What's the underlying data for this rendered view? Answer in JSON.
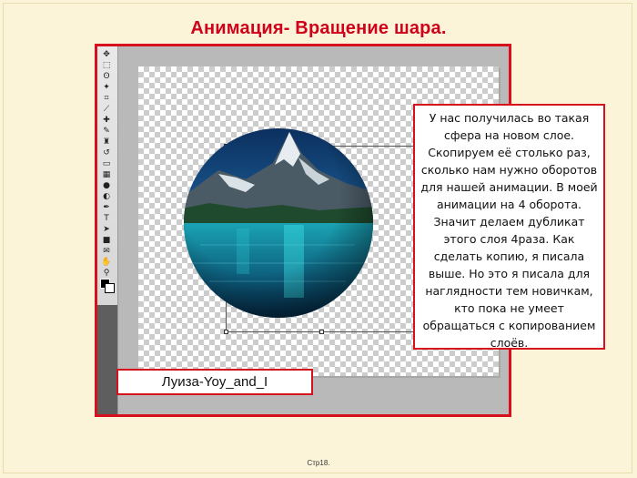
{
  "slide": {
    "title": "Анимация- Вращение шара.",
    "page_number": "Стр18."
  },
  "note": {
    "text": "У нас получилась во такая сфера на новом слое. Скопируем её столько раз, сколько нам нужно оборотов для нашей анимации. В моей анимации на 4 оборота. Значит делаем дубликат этого слоя 4раза. Как сделать копию, я писала выше. Но это я писала для наглядности тем новичкам, кто пока не умеет обращаться с копированием слоёв."
  },
  "signature": {
    "text": "Луиза-Yoy_and_I"
  },
  "toolbar": {
    "tools": [
      "move-tool",
      "marquee-tool",
      "lasso-tool",
      "magic-wand-tool",
      "crop-tool",
      "eyedropper-tool",
      "healing-brush-tool",
      "brush-tool",
      "clone-stamp-tool",
      "history-brush-tool",
      "eraser-tool",
      "gradient-tool",
      "blur-tool",
      "dodge-tool",
      "pen-tool",
      "type-tool",
      "path-selection-tool",
      "shape-tool",
      "notes-tool",
      "hand-tool",
      "zoom-tool"
    ]
  },
  "colors": {
    "accent": "#d7101e",
    "slide_background": "#fbf4d8"
  }
}
